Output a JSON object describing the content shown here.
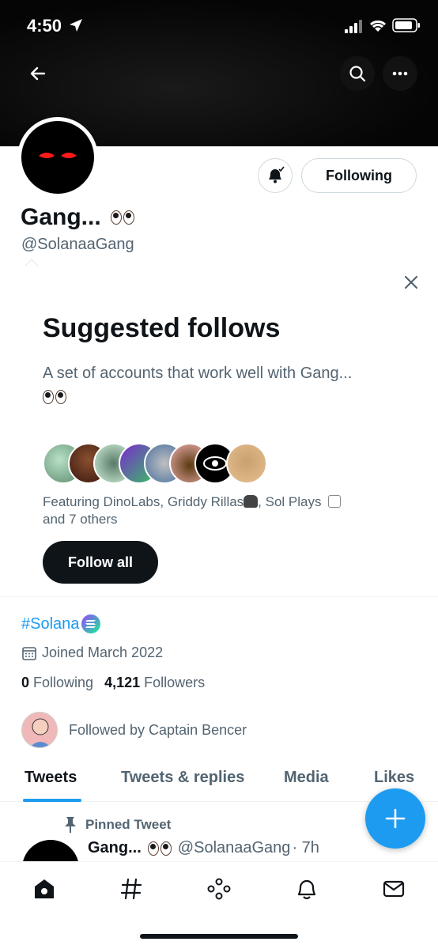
{
  "status_bar": {
    "time": "4:50"
  },
  "profile": {
    "display_name": "Gang...",
    "handle": "@SolanaaGang",
    "following_button": "Following",
    "bio_hashtag": "#Solana",
    "joined": "Joined March 2022",
    "following_count": "0",
    "following_label": "Following",
    "followers_count": "4,121",
    "followers_label": "Followers",
    "followed_by": "Followed by Captain Bencer"
  },
  "suggested_follows": {
    "title": "Suggested follows",
    "description": "A set of accounts that work well with Gang...",
    "featuring_line1": "Featuring DinoLabs, Griddy Rillas",
    "featuring_line1b": ", Sol Plays",
    "featuring_line2": "and 7 others",
    "follow_all_label": "Follow all"
  },
  "tabs": [
    {
      "label": "Tweets",
      "active": true
    },
    {
      "label": "Tweets & replies",
      "active": false
    },
    {
      "label": "Media",
      "active": false
    },
    {
      "label": "Likes",
      "active": false
    }
  ],
  "pinned_tweet": {
    "label": "Pinned Tweet",
    "author_name": "Gang...",
    "author_handle": "@SolanaaGang",
    "time": "· 7h"
  },
  "bottom_nav": [
    "home-icon",
    "explore-hashtag-icon",
    "spaces-icon",
    "notifications-icon",
    "messages-icon"
  ],
  "colors": {
    "accent": "#1d9bf0",
    "text": "#0f1419",
    "secondary": "#536471"
  }
}
